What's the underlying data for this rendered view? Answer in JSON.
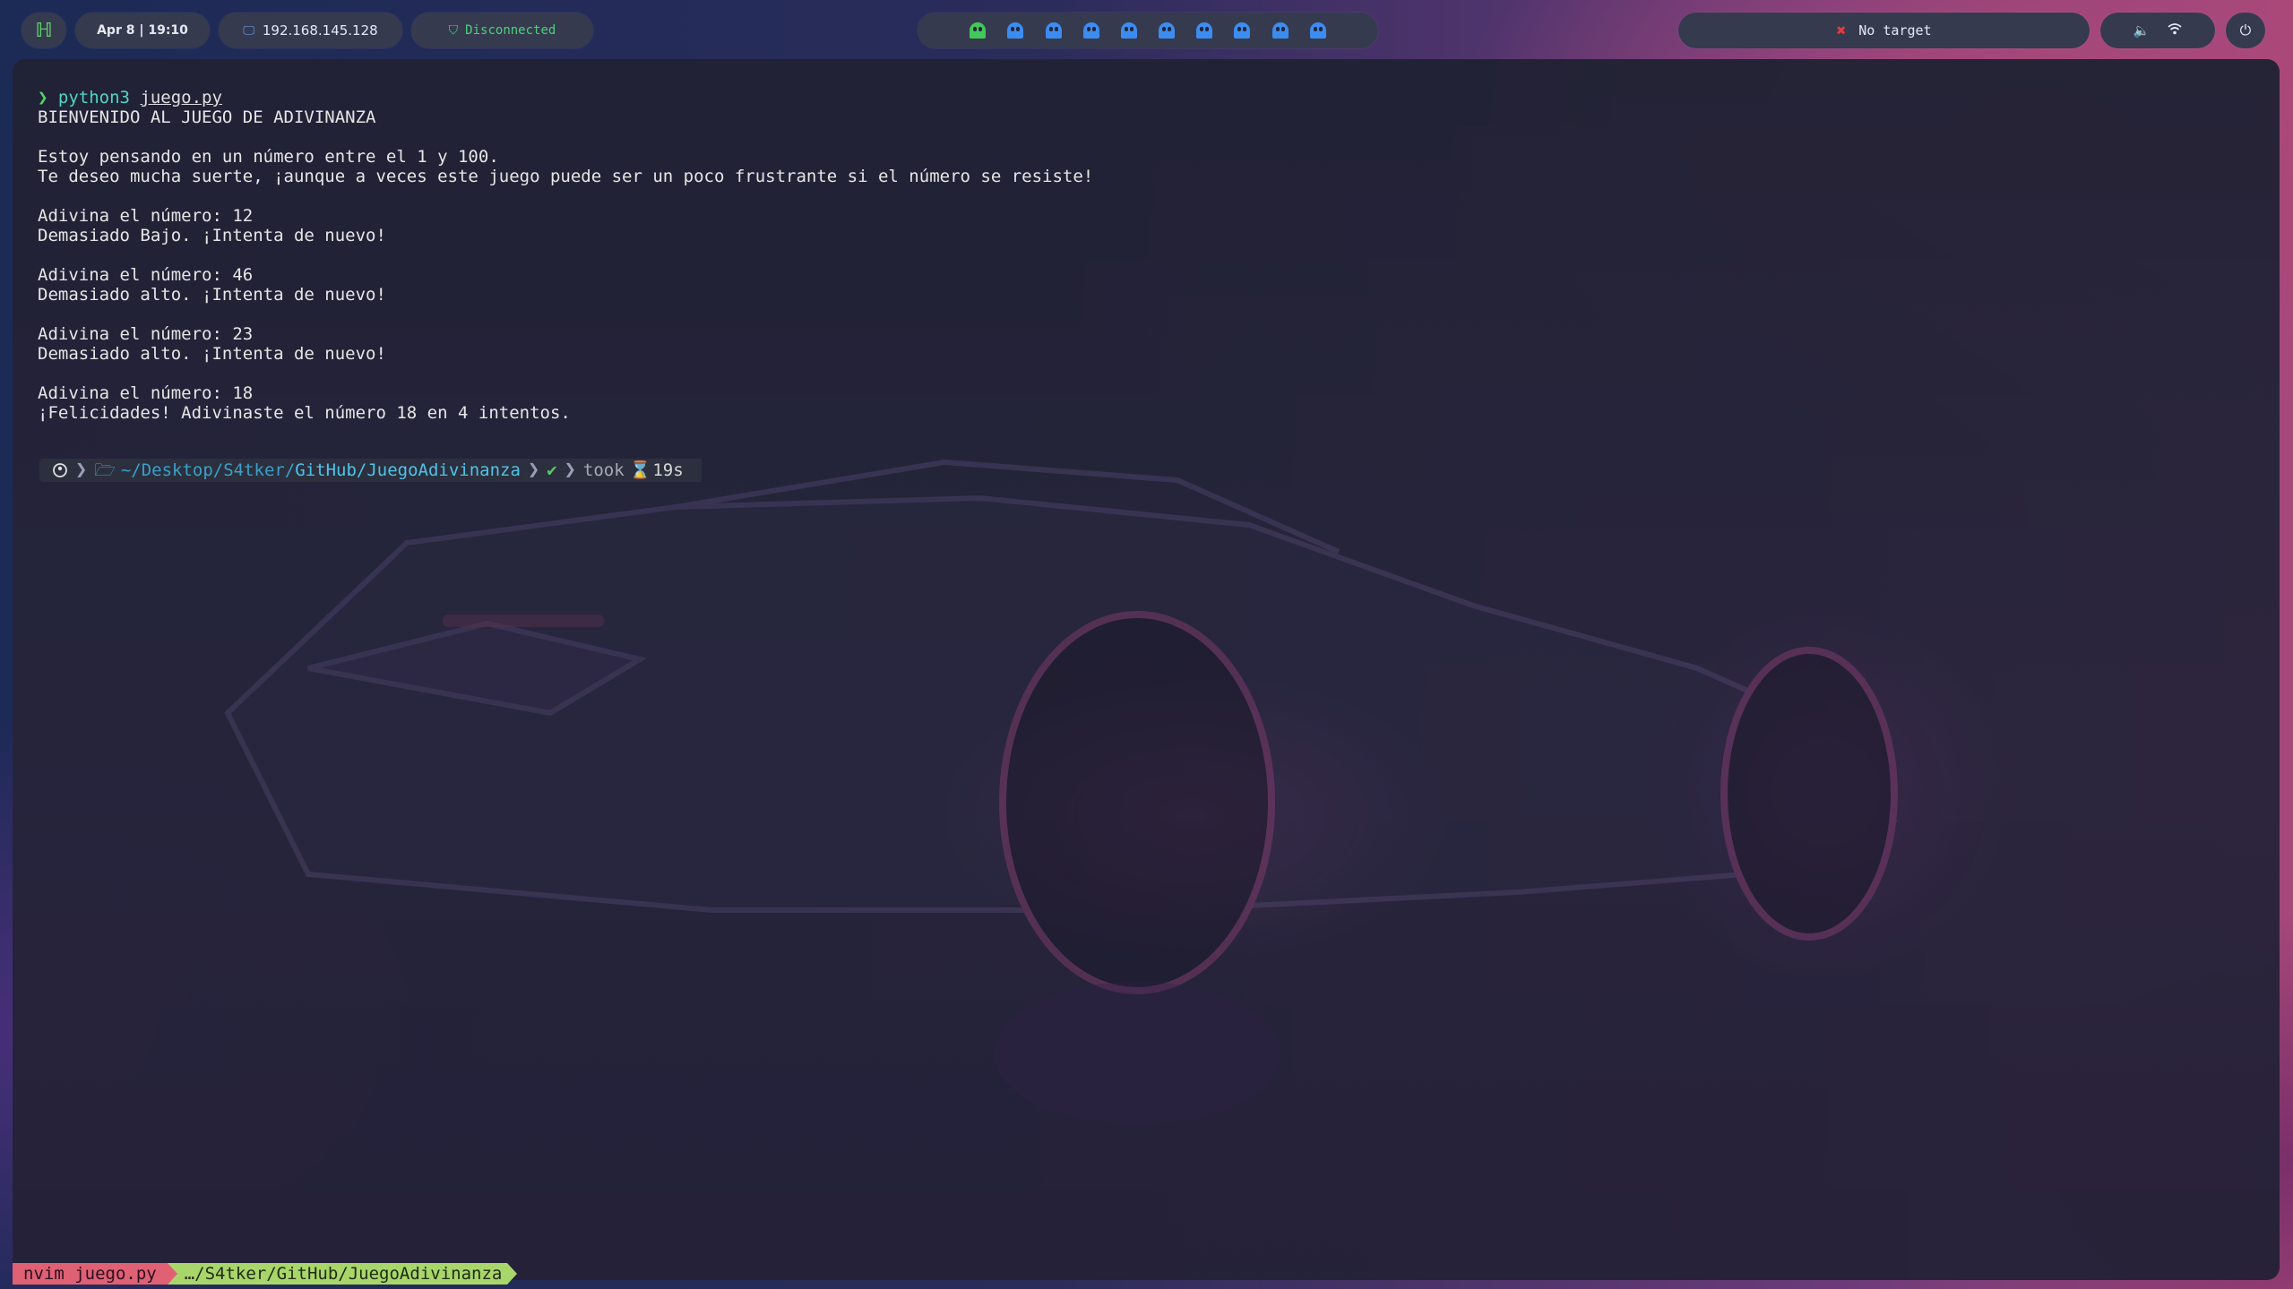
{
  "topbar": {
    "logo": "ℍ",
    "datetime": "Apr 8 | 19:10",
    "ip_address": "192.168.145.128",
    "vpn_status": "Disconnected",
    "target": "No target",
    "workspaces": [
      {
        "name": "ghost-1",
        "active": true
      },
      {
        "name": "ghost-2",
        "active": false
      },
      {
        "name": "ghost-3",
        "active": false
      },
      {
        "name": "ghost-4",
        "active": false
      },
      {
        "name": "ghost-5",
        "active": false
      },
      {
        "name": "ghost-6",
        "active": false
      },
      {
        "name": "ghost-7",
        "active": false
      },
      {
        "name": "ghost-8",
        "active": false
      },
      {
        "name": "ghost-9",
        "active": false
      },
      {
        "name": "ghost-10",
        "active": false
      }
    ],
    "colors": {
      "pill": "#363a4f",
      "active_ghost": "#42c85a",
      "ghost": "#3c8cf0",
      "vpn": "#4bd07a",
      "target_x": "#e53a3a"
    }
  },
  "terminal": {
    "command": "python3",
    "argument": "juego.py",
    "lines": [
      "BIENVENIDO AL JUEGO DE ADIVINANZA",
      "",
      "Estoy pensando en un número entre el 1 y 100.",
      "Te deseo mucha suerte, ¡aunque a veces este juego puede ser un poco frustrante si el número se resiste!",
      "",
      "Adivina el número: 12",
      "Demasiado Bajo. ¡Intenta de nuevo!",
      "",
      "Adivina el número: 46",
      "Demasiado alto. ¡Intenta de nuevo!",
      "",
      "Adivina el número: 23",
      "Demasiado alto. ¡Intenta de nuevo!",
      "",
      "Adivina el número: 18",
      "¡Felicidades! Adivinaste el número 18 en 4 intentos."
    ],
    "prompt": {
      "path_dim": "~/Desktop/S4tker/",
      "path_bold": "GitHub/JuegoAdivinanza",
      "status": "✔",
      "took_label": "took",
      "duration": "19s"
    }
  },
  "statusline": {
    "mode": "nvim juego.py",
    "path": "…/S4tker/GitHub/JuegoAdivinanza",
    "colors": {
      "mode_bg": "#e06074",
      "path_bg": "#a8d66a"
    }
  }
}
